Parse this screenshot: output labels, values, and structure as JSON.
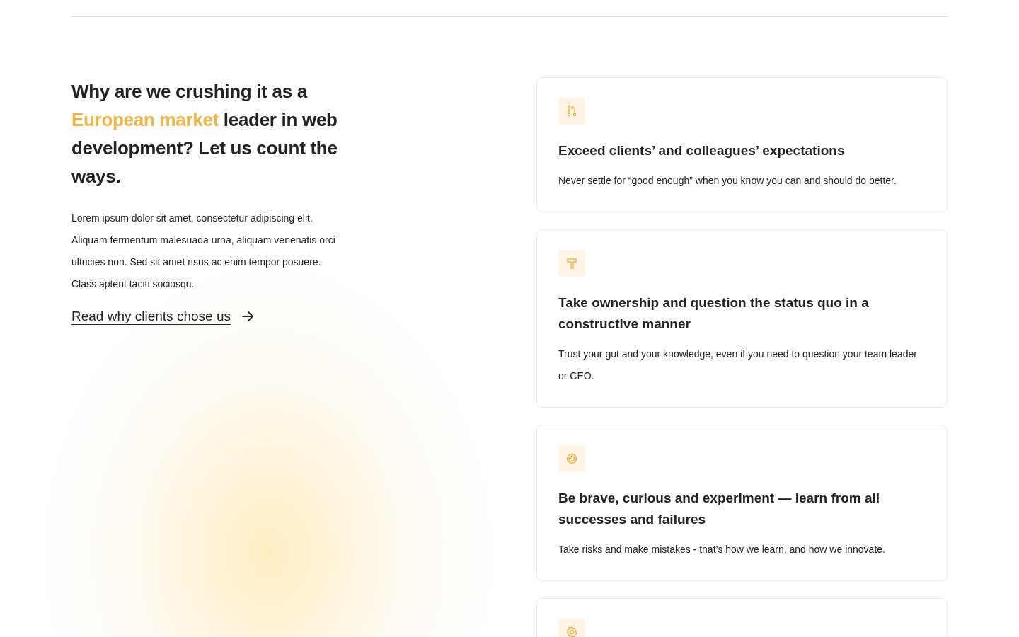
{
  "intro": {
    "heading": [
      {
        "text": "Why are we crushing it as a ",
        "highlight": false
      },
      {
        "text": "European market",
        "highlight": true
      },
      {
        "text": " leader in web development? Let us count the ways.",
        "highlight": false
      }
    ],
    "paragraph": "Lorem ipsum dolor sit amet, consectetur adipiscing elit. Aliquam fermentum malesuada urna, aliquam venenatis orci ultricies non. Sed sit amet risus ac enim tempor posuere. Class aptent taciti sociosqu.",
    "link": "Read why clients chose us"
  },
  "cards": [
    {
      "kind": "merge",
      "title": "Exceed clients’ and colleagues’ expectations",
      "text": "Never settle for “good enough” when you know you can and should do better."
    },
    {
      "kind": "hammer",
      "title": "Take ownership and question the status quo in a constructive manner",
      "text": "Trust your gut and your knowledge, even if you need to question your team leader or CEO."
    },
    {
      "kind": "spiral",
      "title": "Be brave, curious and experiment — learn from all successes and failures",
      "text": "Take risks and make mistakes - that’s how we learn, and how we innovate."
    },
    {
      "kind": "gear"
    }
  ]
}
